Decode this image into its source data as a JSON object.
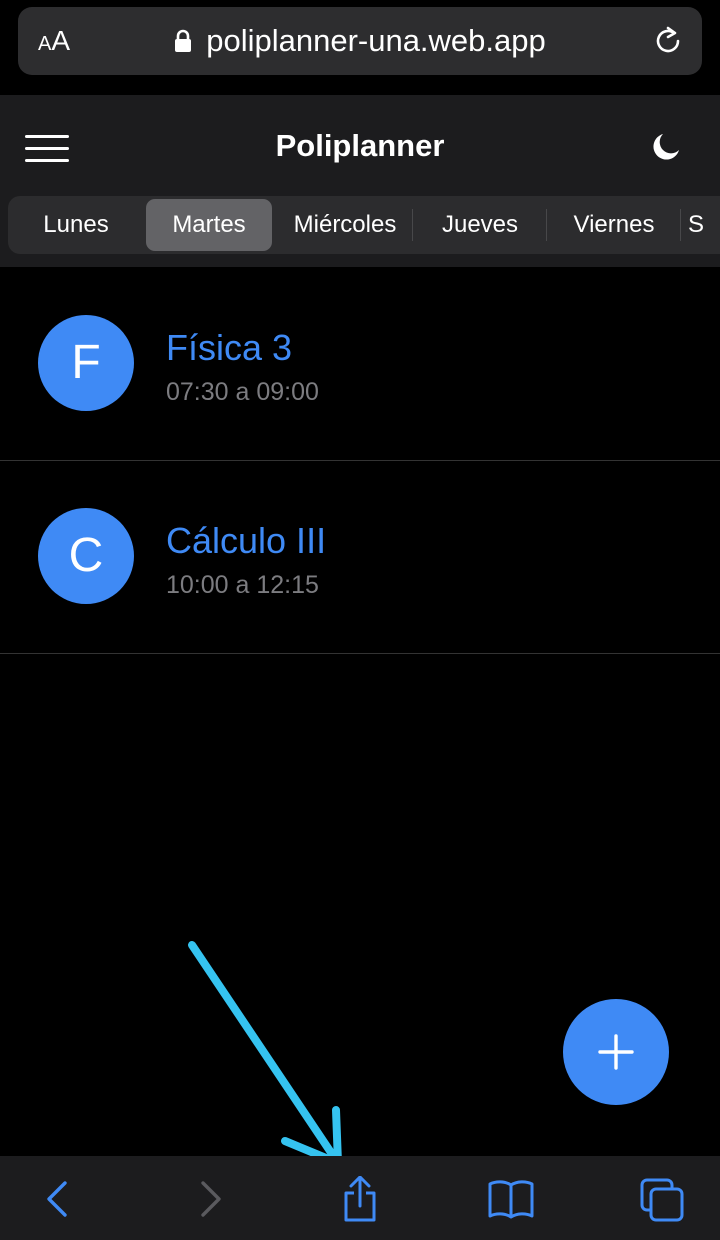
{
  "browser": {
    "text_size_label": "AA",
    "url": "poliplanner-una.web.app",
    "icons": {
      "lock": "lock-icon",
      "reload": "reload-icon"
    }
  },
  "app": {
    "title": "Poliplanner",
    "icons": {
      "menu": "hamburger-menu-icon",
      "theme": "moon-icon"
    }
  },
  "tabs": [
    {
      "label": "Lunes"
    },
    {
      "label": "Martes",
      "active": true
    },
    {
      "label": "Miércoles"
    },
    {
      "label": "Jueves"
    },
    {
      "label": "Viernes"
    },
    {
      "label": "S"
    }
  ],
  "courses": [
    {
      "initial": "F",
      "name": "Física 3",
      "time": "07:30 a 09:00"
    },
    {
      "initial": "C",
      "name": "Cálculo III",
      "time": "10:00 a 12:15"
    }
  ],
  "fab": {
    "icon": "plus-icon"
  },
  "toolbar": {
    "icons": [
      "back-icon",
      "forward-icon",
      "share-icon",
      "bookmarks-icon",
      "tabs-icon"
    ]
  },
  "colors": {
    "accent": "#3f8af5",
    "annotation_arrow": "#35c3f0",
    "header_bg": "#1c1c1e",
    "page_bg": "#000000"
  }
}
